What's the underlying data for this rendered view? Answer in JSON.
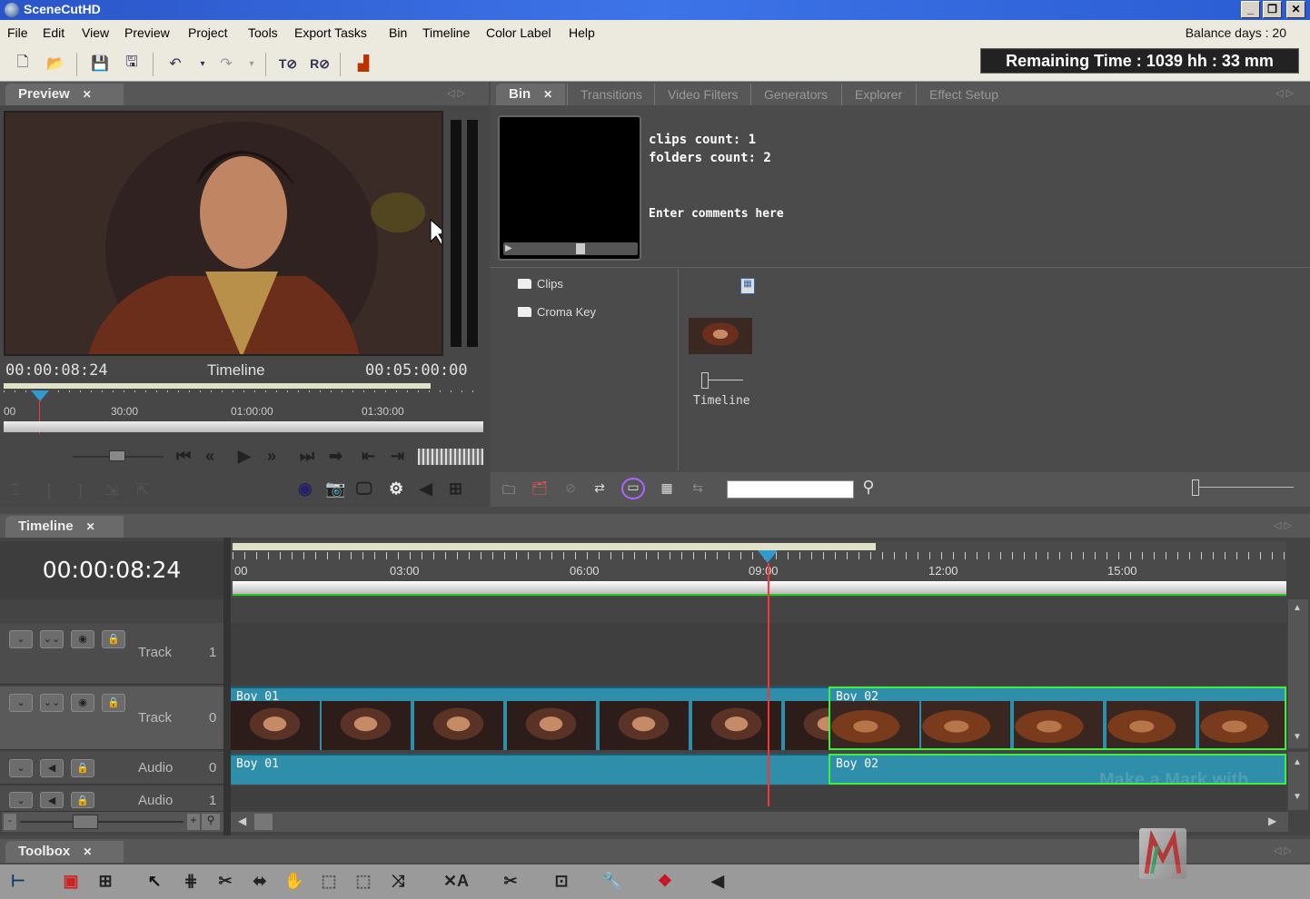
{
  "app": {
    "title": "SceneCutHD"
  },
  "menu": [
    "File",
    "Edit",
    "View",
    "Preview",
    "Project",
    "Tools",
    "Export Tasks",
    "Bin",
    "Timeline",
    "Color Label",
    "Help"
  ],
  "balance": "Balance days : 20",
  "remaining": "Remaining Time : 1039 hh : 33 mm",
  "preview": {
    "tab": "Preview",
    "current_time": "00:00:08:24",
    "source": "Timeline",
    "duration": "00:05:00:00",
    "ruler_ticks": [
      "00",
      "30:00",
      "01:00:00",
      "01:30:00"
    ]
  },
  "bin": {
    "tabs": [
      "Bin",
      "Transitions",
      "Video Filters",
      "Generators",
      "Explorer",
      "Effect Setup"
    ],
    "info_line1": "clips count: 1",
    "info_line2": "folders count: 2",
    "comment": "Enter comments here",
    "folders": [
      "Clips",
      "Croma Key"
    ],
    "item_label": "Timeline",
    "search_value": ""
  },
  "timeline": {
    "tab": "Timeline",
    "current_time": "00:00:08:24",
    "ruler_ticks": [
      "00",
      "03:00",
      "06:00",
      "09:00",
      "12:00",
      "15:00"
    ],
    "tracks": [
      {
        "label": "Track",
        "index": "1"
      },
      {
        "label": "Track",
        "index": "0"
      },
      {
        "label": "Audio",
        "index": "0"
      },
      {
        "label": "Audio",
        "index": "1"
      }
    ],
    "video_clips": [
      "Boy 01",
      "Boy 02"
    ],
    "audio_clips": [
      "Boy 01",
      "Boy 02"
    ],
    "watermark": "Make a Mark with"
  },
  "toolbox": {
    "tab": "Toolbox"
  },
  "colors": {
    "accent": "#2f8eaa",
    "selection": "#3cf03c",
    "playhead": "#ff3b3b"
  }
}
